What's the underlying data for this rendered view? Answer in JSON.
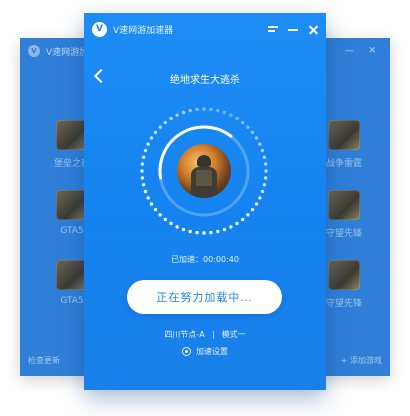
{
  "left_window": {
    "title": "V速网游加速器",
    "games": [
      {
        "label": "堡垒之夜"
      },
      {
        "label": "GTA5"
      },
      {
        "label": "GTA5"
      }
    ],
    "footer": "检查更新"
  },
  "right_window": {
    "games": [
      {
        "label": "战争雷霆"
      },
      {
        "label": "守望先锋"
      },
      {
        "label": "守望先锋"
      }
    ],
    "footer": "+ 添加游戏"
  },
  "main_window": {
    "title": "V速网游加速器",
    "logo_letter": "V",
    "game_title": "绝地求生大逃杀",
    "elapsed_label": "已加速：",
    "elapsed_time": "00:00:40",
    "accelerate_button": "正在努力加载中...",
    "node": "四川节点-A",
    "mode": "模式一",
    "settings_label": "加速设置",
    "progress": 0.38
  },
  "colors": {
    "primary": "#1d8cf5",
    "button_text": "#1e86ef",
    "background_window": "#2f7fd8"
  },
  "icons": [
    "app-logo-icon",
    "menu-icon",
    "minimize-icon",
    "close-icon",
    "back-arrow-icon",
    "gear-icon"
  ]
}
